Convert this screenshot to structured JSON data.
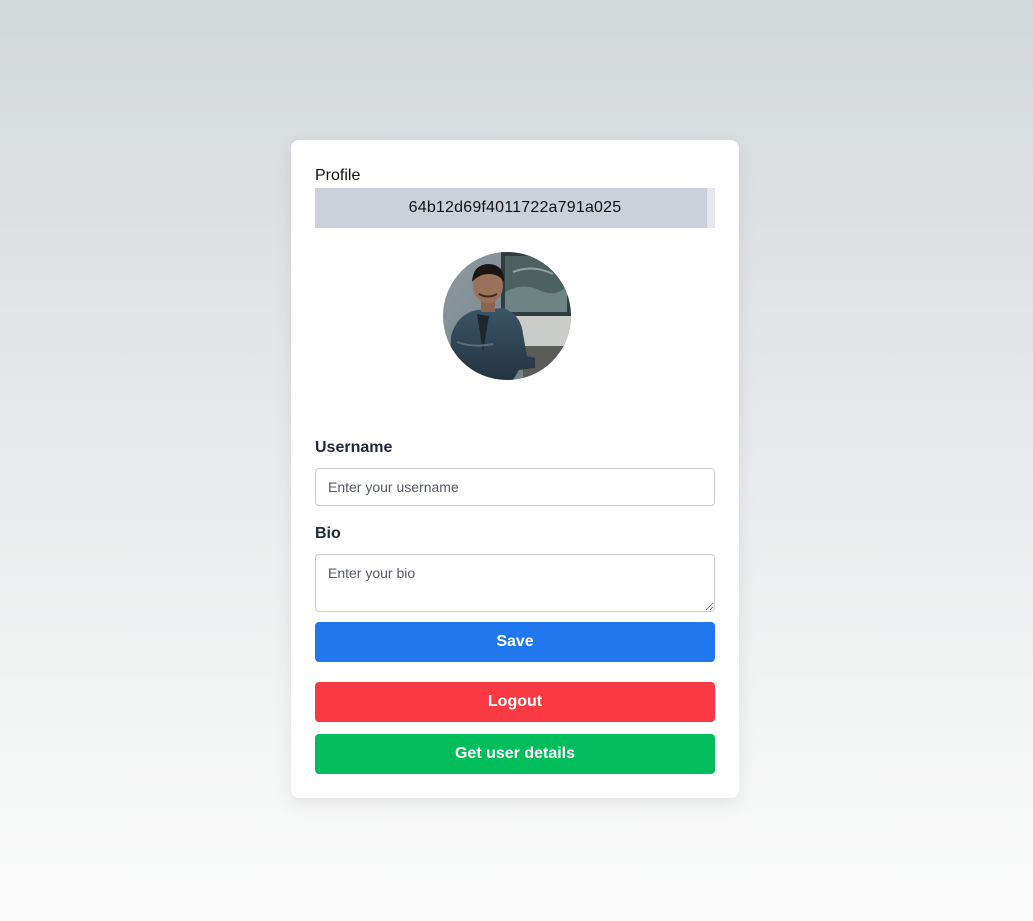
{
  "profile": {
    "heading": "Profile",
    "user_id": "64b12d69f4011722a791a025"
  },
  "form": {
    "username_label": "Username",
    "username_placeholder": "Enter your username",
    "username_value": "",
    "bio_label": "Bio",
    "bio_placeholder": "Enter your bio",
    "bio_value": ""
  },
  "buttons": {
    "save_label": "Save",
    "logout_label": "Logout",
    "details_label": "Get user details"
  },
  "colors": {
    "save": "#2077ee",
    "logout": "#fb3942",
    "details": "#02bd5b",
    "id_bar": "#cbd1d9"
  },
  "icons": {
    "avatar": "user-photo"
  }
}
